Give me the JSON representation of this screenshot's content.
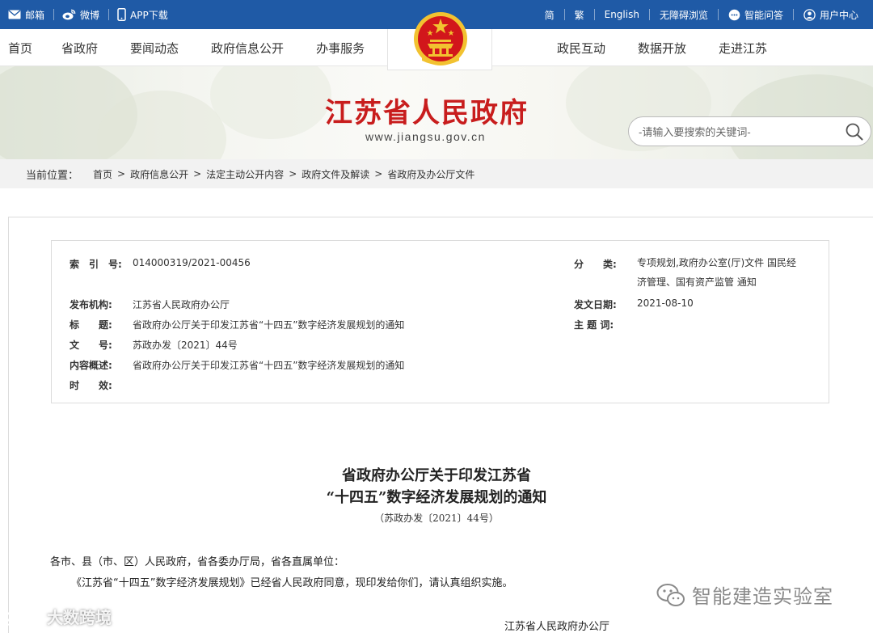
{
  "topbar": {
    "left": [
      {
        "label": "邮箱",
        "icon": "mail-icon"
      },
      {
        "label": "微博",
        "icon": "weibo-icon"
      },
      {
        "label": "APP下载",
        "icon": "mobile-icon"
      }
    ],
    "right": [
      {
        "label": "简"
      },
      {
        "label": "繁"
      },
      {
        "label": "English"
      },
      {
        "label": "无障碍浏览"
      },
      {
        "label": "智能问答",
        "icon": "chat-icon"
      },
      {
        "label": "用户中心",
        "icon": "user-icon"
      }
    ]
  },
  "nav": {
    "left": [
      "首页",
      "省政府",
      "要闻动态",
      "政府信息公开",
      "办事服务"
    ],
    "right": [
      "政民互动",
      "数据开放",
      "走进江苏"
    ]
  },
  "site": {
    "title": "江苏省人民政府",
    "url": "www.jiangsu.gov.cn",
    "search_placeholder": "-请输入要搜索的关键词-"
  },
  "breadcrumb": {
    "label": "当前位置：",
    "items": [
      "首页",
      "政府信息公开",
      "法定主动公开内容",
      "政府文件及解读",
      "省政府及办公厅文件"
    ],
    "separator": ">"
  },
  "meta": {
    "index_label": "索　引　号:",
    "index_value": "014000319/2021-00456",
    "category_label": "分　　类:",
    "category_value_1": "专项规划,政府办公室(厅)文件 国民经",
    "category_value_2": "济管理、国有资产监管 通知",
    "publisher_label": "发布机构:",
    "publisher_value": "江苏省人民政府办公厅",
    "date_label": "发文日期:",
    "date_value": "2021-08-10",
    "title_label": "标　　题:",
    "title_value": "省政府办公厅关于印发江苏省“十四五”数字经济发展规划的通知",
    "subject_label": "主 题 词:",
    "subject_value": "",
    "docno_label": "文　　号:",
    "docno_value": "苏政办发〔2021〕44号",
    "summary_label": "内容概述:",
    "summary_value": "省政府办公厅关于印发江苏省“十四五”数字经济发展规划的通知",
    "validity_label": "时　　效:",
    "validity_value": ""
  },
  "document": {
    "title_line1": "省政府办公厅关于印发江苏省",
    "title_line2": "“十四五”数字经济发展规划的通知",
    "doc_number": "（苏政办发〔2021〕44号）",
    "salutation": "各市、县（市、区）人民政府，省各委办厅局，省各直属单位：",
    "paragraph": "《江苏省“十四五”数字经济发展规划》已经省人民政府同意，现印发给你们，请认真组织实施。",
    "signature": "江苏省人民政府办公厅"
  },
  "watermarks": {
    "right": "智能建造实验室",
    "left": "大数跨境"
  },
  "colors": {
    "topbar": "#1f5aa6",
    "title_red": "#c81d1d",
    "emblem_red": "#d2161b",
    "emblem_gold": "#f2c230"
  }
}
